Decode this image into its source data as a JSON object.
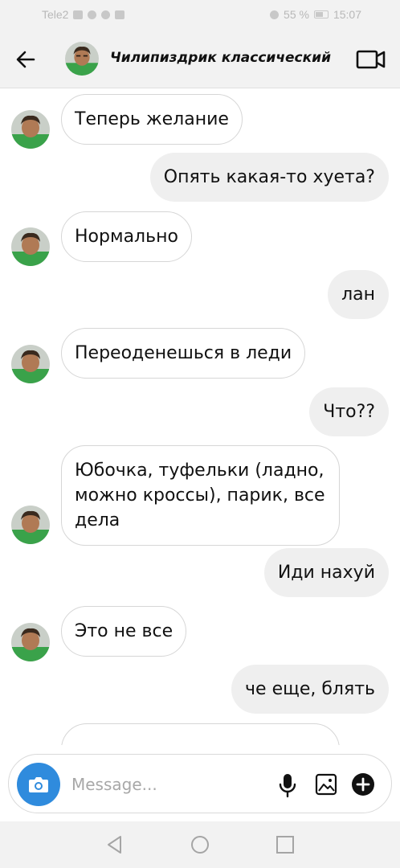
{
  "status_bar": {
    "carrier": "Tele2",
    "battery_percent": "55 %",
    "time": "15:07"
  },
  "header": {
    "back_icon": "arrow-left-icon",
    "contact_name": "Чилипиздрик классический",
    "video_icon": "video-camera-icon"
  },
  "messages": [
    {
      "direction": "in",
      "text": "Теперь желание"
    },
    {
      "direction": "out",
      "text": "Опять какая-то хуета?"
    },
    {
      "direction": "in",
      "text": "Нормально"
    },
    {
      "direction": "out",
      "text": "лан"
    },
    {
      "direction": "in",
      "text": "Переоденешься в леди"
    },
    {
      "direction": "out",
      "text": "Что??"
    },
    {
      "direction": "in",
      "text": "Юбочка, туфельки (ладно, можно кроссы), парик, все дела"
    },
    {
      "direction": "out",
      "text": "Иди нахуй"
    },
    {
      "direction": "in",
      "text": "Это не все"
    },
    {
      "direction": "out",
      "text": "че еще, блять"
    }
  ],
  "composer": {
    "placeholder": "Message...",
    "value": "",
    "icons": [
      "camera-icon",
      "microphone-icon",
      "gallery-icon",
      "plus-circle-icon"
    ]
  },
  "colors": {
    "accent": "#2f8bdd",
    "bar_bg": "#f2f2f2",
    "outgoing_bubble": "#efefef",
    "incoming_border": "#d6d6d6"
  }
}
